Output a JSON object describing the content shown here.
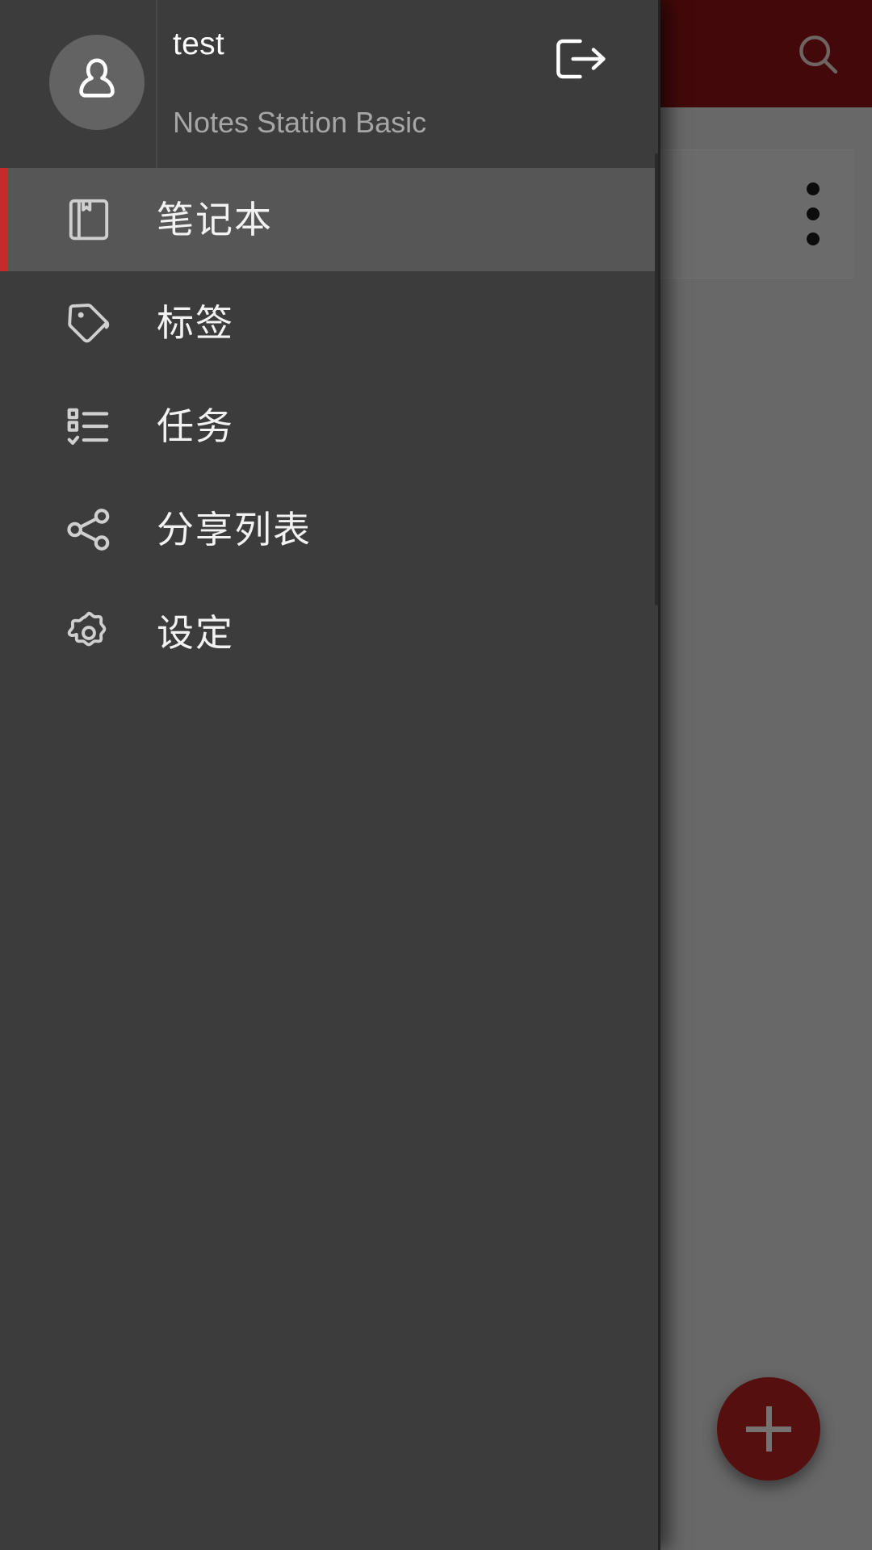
{
  "background": {
    "appbar": {
      "bg_color": "#7b1113",
      "search_icon": "search-icon"
    },
    "card": {
      "overflow_icon": "more-vertical-icon"
    },
    "fab": {
      "icon": "plus-icon",
      "bg_color": "#9b1c1c"
    }
  },
  "drawer": {
    "bg_color": "#3c3c3c",
    "account": {
      "avatar_icon": "person-icon",
      "user_name": "test",
      "plan_name": "Notes Station Basic",
      "logout_icon": "logout-icon"
    },
    "accent_color": "#c62b2b",
    "items": [
      {
        "label": "笔记本",
        "icon": "notebook-icon",
        "active": true
      },
      {
        "label": "标签",
        "icon": "tag-icon",
        "active": false
      },
      {
        "label": "任务",
        "icon": "checklist-icon",
        "active": false
      },
      {
        "label": "分享列表",
        "icon": "share-icon",
        "active": false
      },
      {
        "label": "设定",
        "icon": "gear-icon",
        "active": false
      }
    ]
  }
}
